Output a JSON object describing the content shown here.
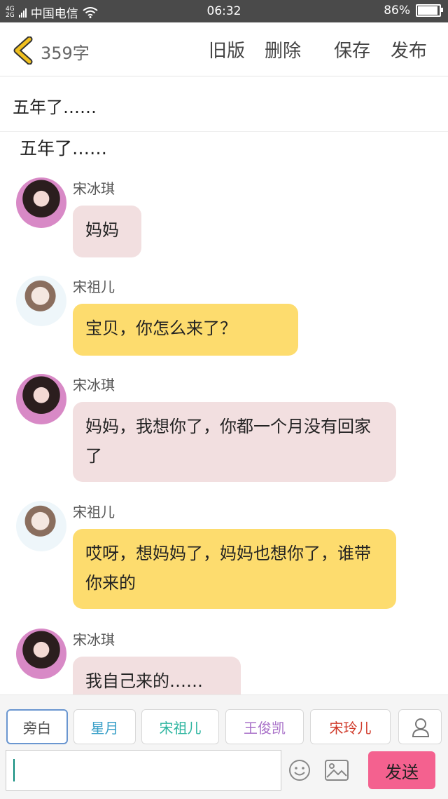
{
  "status_bar": {
    "network": [
      "4G",
      "2G"
    ],
    "carrier": "中国电信",
    "time": "06:32",
    "battery": "86%",
    "battery_level": 0.86
  },
  "header": {
    "word_count": "359字",
    "old_version": "旧版",
    "delete": "删除",
    "save": "保存",
    "publish": "发布",
    "accent_color": "#f0c020"
  },
  "document": {
    "title_input": "五年了……",
    "subtitle": "五年了……"
  },
  "messages": [
    {
      "name": "宋冰琪",
      "text": "妈妈",
      "style": "pink",
      "avatar": "girl-avatar-1"
    },
    {
      "name": "宋祖儿",
      "text": "宝贝，你怎么来了？",
      "style": "yellow",
      "avatar": "girl-avatar-2"
    },
    {
      "name": "宋冰琪",
      "text": "妈妈，我想你了，你都一个月没有回家了",
      "style": "pink",
      "avatar": "girl-avatar-1"
    },
    {
      "name": "宋祖儿",
      "text": "哎呀，想妈妈了，妈妈也想你了，谁带你来的",
      "style": "yellow",
      "avatar": "girl-avatar-2"
    },
    {
      "name": "宋冰琪",
      "text": "我自己来的……",
      "style": "pink",
      "avatar": "girl-avatar-1"
    }
  ],
  "roles": [
    {
      "label": "旁白",
      "color": "#555555",
      "selected": true
    },
    {
      "label": "星月",
      "color": "#3aa0c8"
    },
    {
      "label": "宋祖儿",
      "color": "#2eb5a0"
    },
    {
      "label": "王俊凯",
      "color": "#a870c8"
    },
    {
      "label": "宋玲儿",
      "color": "#d03a2a"
    }
  ],
  "composer": {
    "input_value": "",
    "send": "发送",
    "send_color": "#f4618f"
  },
  "colors": {
    "bubble_pink": "#f2dfe0",
    "bubble_yellow": "#fddc6e",
    "selected_role_border": "#6a96d0"
  }
}
